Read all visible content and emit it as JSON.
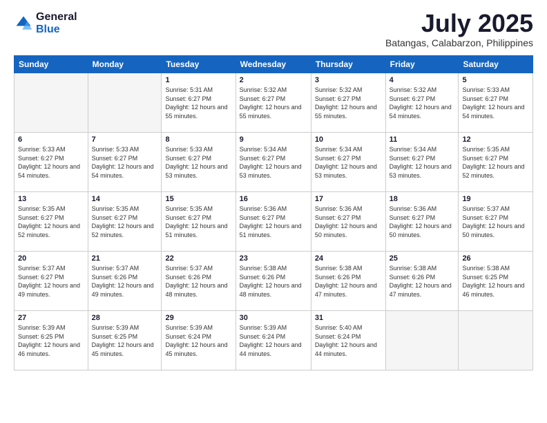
{
  "logo": {
    "general": "General",
    "blue": "Blue"
  },
  "header": {
    "month": "July 2025",
    "location": "Batangas, Calabarzon, Philippines"
  },
  "weekdays": [
    "Sunday",
    "Monday",
    "Tuesday",
    "Wednesday",
    "Thursday",
    "Friday",
    "Saturday"
  ],
  "weeks": [
    [
      {
        "day": "",
        "info": ""
      },
      {
        "day": "",
        "info": ""
      },
      {
        "day": "1",
        "info": "Sunrise: 5:31 AM\nSunset: 6:27 PM\nDaylight: 12 hours and 55 minutes."
      },
      {
        "day": "2",
        "info": "Sunrise: 5:32 AM\nSunset: 6:27 PM\nDaylight: 12 hours and 55 minutes."
      },
      {
        "day": "3",
        "info": "Sunrise: 5:32 AM\nSunset: 6:27 PM\nDaylight: 12 hours and 55 minutes."
      },
      {
        "day": "4",
        "info": "Sunrise: 5:32 AM\nSunset: 6:27 PM\nDaylight: 12 hours and 54 minutes."
      },
      {
        "day": "5",
        "info": "Sunrise: 5:33 AM\nSunset: 6:27 PM\nDaylight: 12 hours and 54 minutes."
      }
    ],
    [
      {
        "day": "6",
        "info": "Sunrise: 5:33 AM\nSunset: 6:27 PM\nDaylight: 12 hours and 54 minutes."
      },
      {
        "day": "7",
        "info": "Sunrise: 5:33 AM\nSunset: 6:27 PM\nDaylight: 12 hours and 54 minutes."
      },
      {
        "day": "8",
        "info": "Sunrise: 5:33 AM\nSunset: 6:27 PM\nDaylight: 12 hours and 53 minutes."
      },
      {
        "day": "9",
        "info": "Sunrise: 5:34 AM\nSunset: 6:27 PM\nDaylight: 12 hours and 53 minutes."
      },
      {
        "day": "10",
        "info": "Sunrise: 5:34 AM\nSunset: 6:27 PM\nDaylight: 12 hours and 53 minutes."
      },
      {
        "day": "11",
        "info": "Sunrise: 5:34 AM\nSunset: 6:27 PM\nDaylight: 12 hours and 53 minutes."
      },
      {
        "day": "12",
        "info": "Sunrise: 5:35 AM\nSunset: 6:27 PM\nDaylight: 12 hours and 52 minutes."
      }
    ],
    [
      {
        "day": "13",
        "info": "Sunrise: 5:35 AM\nSunset: 6:27 PM\nDaylight: 12 hours and 52 minutes."
      },
      {
        "day": "14",
        "info": "Sunrise: 5:35 AM\nSunset: 6:27 PM\nDaylight: 12 hours and 52 minutes."
      },
      {
        "day": "15",
        "info": "Sunrise: 5:35 AM\nSunset: 6:27 PM\nDaylight: 12 hours and 51 minutes."
      },
      {
        "day": "16",
        "info": "Sunrise: 5:36 AM\nSunset: 6:27 PM\nDaylight: 12 hours and 51 minutes."
      },
      {
        "day": "17",
        "info": "Sunrise: 5:36 AM\nSunset: 6:27 PM\nDaylight: 12 hours and 50 minutes."
      },
      {
        "day": "18",
        "info": "Sunrise: 5:36 AM\nSunset: 6:27 PM\nDaylight: 12 hours and 50 minutes."
      },
      {
        "day": "19",
        "info": "Sunrise: 5:37 AM\nSunset: 6:27 PM\nDaylight: 12 hours and 50 minutes."
      }
    ],
    [
      {
        "day": "20",
        "info": "Sunrise: 5:37 AM\nSunset: 6:27 PM\nDaylight: 12 hours and 49 minutes."
      },
      {
        "day": "21",
        "info": "Sunrise: 5:37 AM\nSunset: 6:26 PM\nDaylight: 12 hours and 49 minutes."
      },
      {
        "day": "22",
        "info": "Sunrise: 5:37 AM\nSunset: 6:26 PM\nDaylight: 12 hours and 48 minutes."
      },
      {
        "day": "23",
        "info": "Sunrise: 5:38 AM\nSunset: 6:26 PM\nDaylight: 12 hours and 48 minutes."
      },
      {
        "day": "24",
        "info": "Sunrise: 5:38 AM\nSunset: 6:26 PM\nDaylight: 12 hours and 47 minutes."
      },
      {
        "day": "25",
        "info": "Sunrise: 5:38 AM\nSunset: 6:26 PM\nDaylight: 12 hours and 47 minutes."
      },
      {
        "day": "26",
        "info": "Sunrise: 5:38 AM\nSunset: 6:25 PM\nDaylight: 12 hours and 46 minutes."
      }
    ],
    [
      {
        "day": "27",
        "info": "Sunrise: 5:39 AM\nSunset: 6:25 PM\nDaylight: 12 hours and 46 minutes."
      },
      {
        "day": "28",
        "info": "Sunrise: 5:39 AM\nSunset: 6:25 PM\nDaylight: 12 hours and 45 minutes."
      },
      {
        "day": "29",
        "info": "Sunrise: 5:39 AM\nSunset: 6:24 PM\nDaylight: 12 hours and 45 minutes."
      },
      {
        "day": "30",
        "info": "Sunrise: 5:39 AM\nSunset: 6:24 PM\nDaylight: 12 hours and 44 minutes."
      },
      {
        "day": "31",
        "info": "Sunrise: 5:40 AM\nSunset: 6:24 PM\nDaylight: 12 hours and 44 minutes."
      },
      {
        "day": "",
        "info": ""
      },
      {
        "day": "",
        "info": ""
      }
    ]
  ]
}
